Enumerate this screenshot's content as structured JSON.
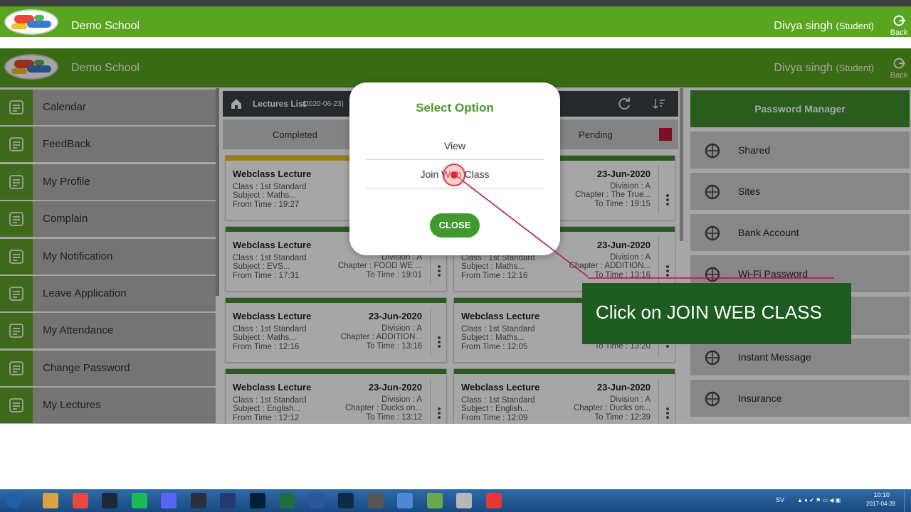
{
  "app": {
    "school_name": "Demo School",
    "user_name": "Divya singh",
    "user_role": "(Student)",
    "back_label": "Back"
  },
  "sidebar": {
    "items": [
      {
        "label": "Calendar",
        "icon": "calendar-icon"
      },
      {
        "label": "FeedBack",
        "icon": "feedback-icon"
      },
      {
        "label": "My Profile",
        "icon": "profile-icon"
      },
      {
        "label": "Complain",
        "icon": "complain-icon"
      },
      {
        "label": "My Notification",
        "icon": "bell-icon"
      },
      {
        "label": "Leave Application",
        "icon": "leave-icon"
      },
      {
        "label": "My Attendance",
        "icon": "attendance-icon"
      },
      {
        "label": "Change Password",
        "icon": "lock-icon"
      },
      {
        "label": "My Lectures",
        "icon": "lectures-icon"
      }
    ]
  },
  "lectures": {
    "title": "Lectures List",
    "date": "(2020-06-23)",
    "tabs": {
      "completed": "Completed",
      "pending": "Pending"
    },
    "cards": [
      {
        "title": "Webclass Lecture",
        "date": "",
        "class": "Class : 1st Standard",
        "subject": "Subject : Maths...",
        "from": "From Time : 19:27",
        "division": "",
        "chapter": "C",
        "to": "",
        "bar": "#f0c419"
      },
      {
        "title": "",
        "date": "23-Jun-2020",
        "class": "",
        "subject": "",
        "from": "",
        "division": "Division : A",
        "chapter": "Chapter : The True...",
        "to": "To Time : 19:15",
        "bar": "#3e8d2c"
      },
      {
        "title": "Webclass Lecture",
        "date": "",
        "class": "Class : 1st Standard",
        "subject": "Subject : EVS...",
        "from": "From Time : 17:31",
        "division": "Division : A",
        "chapter": "Chapter : FOOD WE ...",
        "to": "To Time : 19:01",
        "bar": "#3e8d2c"
      },
      {
        "title": "",
        "date": "23-Jun-2020",
        "class": "Class : 1st Standard",
        "subject": "Subject : Maths...",
        "from": "From Time : 12:16",
        "division": "Division : A",
        "chapter": "Chapter : ADDITION...",
        "to": "To Time : 13:16",
        "bar": "#3e8d2c"
      },
      {
        "title": "Webclass Lecture",
        "date": "23-Jun-2020",
        "class": "Class : 1st Standard",
        "subject": "Subject : Maths...",
        "from": "From Time : 12:16",
        "division": "Division : A",
        "chapter": "Chapter : ADDITION...",
        "to": "To Time : 13:16",
        "bar": "#3e8d2c"
      },
      {
        "title": "Webclass Lecture",
        "date": "",
        "class": "Class : 1st Standard",
        "subject": "Subject : Maths...",
        "from": "From Time : 12:05",
        "division": "",
        "chapter": "Cha",
        "to": "To Time : 13:20",
        "bar": "#3e8d2c"
      },
      {
        "title": "Webclass Lecture",
        "date": "23-Jun-2020",
        "class": "Class : 1st Standard",
        "subject": "Subject : English...",
        "from": "From Time : 12:12",
        "division": "Division : A",
        "chapter": "Chapter : Ducks on...",
        "to": "To Time : 13:12",
        "bar": "#3e8d2c"
      },
      {
        "title": "Webclass Lecture",
        "date": "23-Jun-2020",
        "class": "Class : 1st Standard",
        "subject": "Subject : English...",
        "from": "From Time : 12:09",
        "division": "Division : A",
        "chapter": "Chapter : Ducks on...",
        "to": "To Time : 12:39",
        "bar": "#3e8d2c"
      }
    ]
  },
  "right_panel": {
    "header": "Password Manager",
    "items": [
      {
        "label": "Shared",
        "icon": "share-icon"
      },
      {
        "label": "Sites",
        "icon": "globe-icon"
      },
      {
        "label": "Bank Account",
        "icon": "bank-icon"
      },
      {
        "label": "Wi-Fi Password",
        "icon": "wifi-icon"
      },
      {
        "label": "Instant Message",
        "icon": "message-icon"
      },
      {
        "label": "Insurance",
        "icon": "umbrella-icon"
      }
    ]
  },
  "modal": {
    "title": "Select Option",
    "options": [
      "View",
      "Join Web Class"
    ],
    "close_label": "CLOSE"
  },
  "callout": {
    "text": "Click on JOIN WEB CLASS"
  },
  "taskbar": {
    "time": "10:10",
    "date": "2017-04-28",
    "lang": "SV"
  },
  "colors": {
    "brand_green": "#58a520",
    "dark_green": "#1e5b1f",
    "accent_red": "#c0183a"
  }
}
